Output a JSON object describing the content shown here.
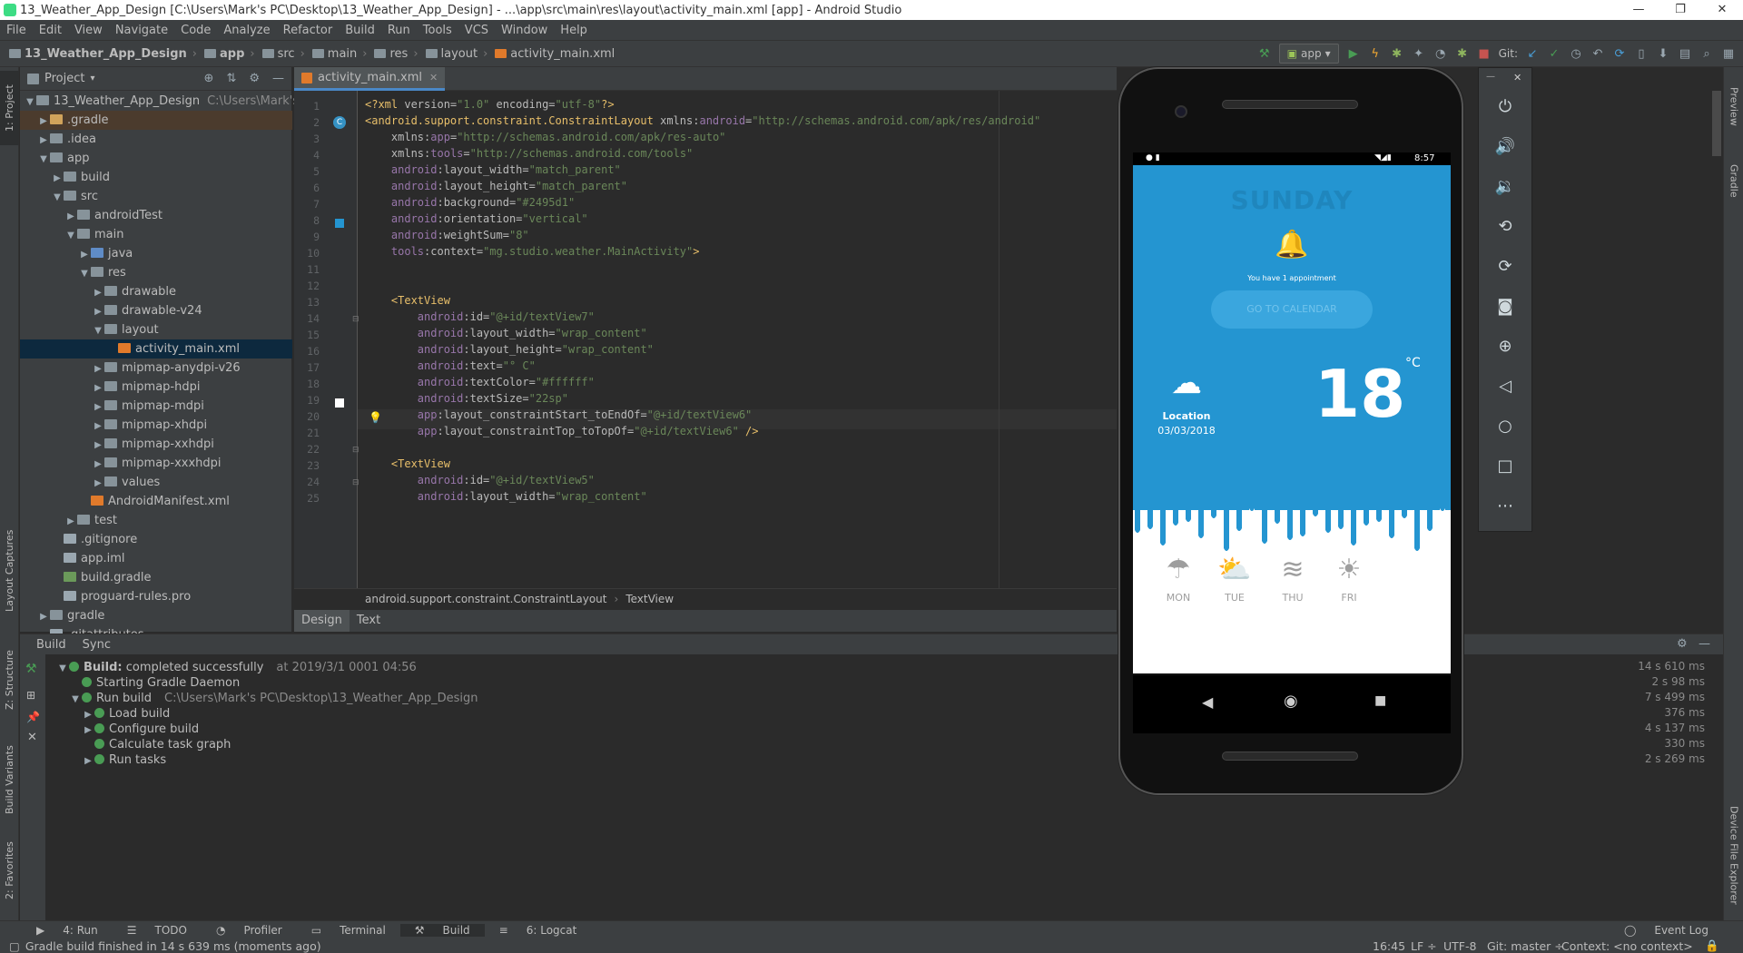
{
  "window": {
    "title": "13_Weather_App_Design [C:\\Users\\Mark's PC\\Desktop\\13_Weather_App_Design] - ...\\app\\src\\main\\res\\layout\\activity_main.xml [app] - Android Studio",
    "controls": [
      "—",
      "❐",
      "✕"
    ]
  },
  "menu": [
    "File",
    "Edit",
    "View",
    "Navigate",
    "Code",
    "Analyze",
    "Refactor",
    "Build",
    "Run",
    "Tools",
    "VCS",
    "Window",
    "Help"
  ],
  "breadcrumb": [
    "13_Weather_App_Design",
    "app",
    "src",
    "main",
    "res",
    "layout",
    "activity_main.xml"
  ],
  "toolbar": {
    "config": "app",
    "git_label": "Git:"
  },
  "project": {
    "header": "Project",
    "items": [
      {
        "label": "13_Weather_App_Design",
        "hint": "C:\\Users\\Mark's PC",
        "depth": 0,
        "arrow": "▼",
        "icon": "fold",
        "bold": false
      },
      {
        "label": ".gradle",
        "depth": 1,
        "arrow": "▶",
        "icon": "fold-o",
        "hl": true
      },
      {
        "label": ".idea",
        "depth": 1,
        "arrow": "▶",
        "icon": "fold"
      },
      {
        "label": "app",
        "depth": 1,
        "arrow": "▼",
        "icon": "fold"
      },
      {
        "label": "build",
        "depth": 2,
        "arrow": "▶",
        "icon": "fold"
      },
      {
        "label": "src",
        "depth": 2,
        "arrow": "▼",
        "icon": "fold"
      },
      {
        "label": "androidTest",
        "depth": 3,
        "arrow": "▶",
        "icon": "fold"
      },
      {
        "label": "main",
        "depth": 3,
        "arrow": "▼",
        "icon": "fold"
      },
      {
        "label": "java",
        "depth": 4,
        "arrow": "▶",
        "icon": "fold-b"
      },
      {
        "label": "res",
        "depth": 4,
        "arrow": "▼",
        "icon": "fold"
      },
      {
        "label": "drawable",
        "depth": 5,
        "arrow": "▶",
        "icon": "fold"
      },
      {
        "label": "drawable-v24",
        "depth": 5,
        "arrow": "▶",
        "icon": "fold"
      },
      {
        "label": "layout",
        "depth": 5,
        "arrow": "▼",
        "icon": "fold"
      },
      {
        "label": "activity_main.xml",
        "depth": 6,
        "arrow": "",
        "icon": "file-x",
        "sel": true
      },
      {
        "label": "mipmap-anydpi-v26",
        "depth": 5,
        "arrow": "▶",
        "icon": "fold"
      },
      {
        "label": "mipmap-hdpi",
        "depth": 5,
        "arrow": "▶",
        "icon": "fold"
      },
      {
        "label": "mipmap-mdpi",
        "depth": 5,
        "arrow": "▶",
        "icon": "fold"
      },
      {
        "label": "mipmap-xhdpi",
        "depth": 5,
        "arrow": "▶",
        "icon": "fold"
      },
      {
        "label": "mipmap-xxhdpi",
        "depth": 5,
        "arrow": "▶",
        "icon": "fold"
      },
      {
        "label": "mipmap-xxxhdpi",
        "depth": 5,
        "arrow": "▶",
        "icon": "fold"
      },
      {
        "label": "values",
        "depth": 5,
        "arrow": "▶",
        "icon": "fold"
      },
      {
        "label": "AndroidManifest.xml",
        "depth": 4,
        "arrow": "",
        "icon": "file-x"
      },
      {
        "label": "test",
        "depth": 3,
        "arrow": "▶",
        "icon": "fold"
      },
      {
        "label": ".gitignore",
        "depth": 2,
        "arrow": "",
        "icon": "file-i"
      },
      {
        "label": "app.iml",
        "depth": 2,
        "arrow": "",
        "icon": "file-i"
      },
      {
        "label": "build.gradle",
        "depth": 2,
        "arrow": "",
        "icon": "file-g"
      },
      {
        "label": "proguard-rules.pro",
        "depth": 2,
        "arrow": "",
        "icon": "file-i"
      },
      {
        "label": "gradle",
        "depth": 1,
        "arrow": "▶",
        "icon": "fold"
      },
      {
        "label": ".gitattributes",
        "depth": 1,
        "arrow": "",
        "icon": "file-i"
      }
    ]
  },
  "editor": {
    "tab": "activity_main.xml",
    "lines": [
      {
        "n": "1",
        "html": "<span class='tag'>&lt;?xml </span><span class='attr'>version=</span><span class='val'>\"1.0\"</span><span class='attr'> encoding=</span><span class='val'>\"utf-8\"</span><span class='tag'>?&gt;</span>"
      },
      {
        "n": "2",
        "html": "<span class='tag'>&lt;android.support.constraint.ConstraintLayout </span><span class='attr'>xmlns:</span><span class='ns'>android</span><span class='attr'>=</span><span class='val'>\"http://schemas.android.com/apk/res/android\"</span>"
      },
      {
        "n": "3",
        "html": "    <span class='attr'>xmlns:</span><span class='ns'>app</span><span class='attr'>=</span><span class='val'>\"http://schemas.android.com/apk/res-auto\"</span>"
      },
      {
        "n": "4",
        "html": "    <span class='attr'>xmlns:</span><span class='ns'>tools</span><span class='attr'>=</span><span class='val'>\"http://schemas.android.com/tools\"</span>"
      },
      {
        "n": "5",
        "html": "    <span class='ns'>android</span><span class='attr'>:layout_width=</span><span class='val'>\"match_parent\"</span>"
      },
      {
        "n": "6",
        "html": "    <span class='ns'>android</span><span class='attr'>:layout_height=</span><span class='val'>\"match_parent\"</span>"
      },
      {
        "n": "7",
        "html": "    <span class='ns'>android</span><span class='attr'>:background=</span><span class='val'>\"#2495d1\"</span>"
      },
      {
        "n": "8",
        "html": "    <span class='ns'>android</span><span class='attr'>:orientation=</span><span class='val'>\"vertical\"</span>"
      },
      {
        "n": "9",
        "html": "    <span class='ns'>android</span><span class='attr'>:weightSum=</span><span class='val'>\"8\"</span>"
      },
      {
        "n": "10",
        "html": "    <span class='ns'>tools</span><span class='attr'>:context=</span><span class='val'>\"mg.studio.weather.MainActivity\"</span><span class='tag'>&gt;</span>"
      },
      {
        "n": "11",
        "html": ""
      },
      {
        "n": "12",
        "html": ""
      },
      {
        "n": "13",
        "html": "    <span class='tag'>&lt;TextView</span>"
      },
      {
        "n": "14",
        "html": "        <span class='ns'>android</span><span class='attr'>:id=</span><span class='val'>\"@+id/textView7\"</span>"
      },
      {
        "n": "15",
        "html": "        <span class='ns'>android</span><span class='attr'>:layout_width=</span><span class='val'>\"wrap_content\"</span>"
      },
      {
        "n": "16",
        "html": "        <span class='ns'>android</span><span class='attr'>:layout_height=</span><span class='val'>\"wrap_content\"</span>"
      },
      {
        "n": "17",
        "html": "        <span class='ns'>android</span><span class='attr'>:text=</span><span class='val'>\"° C\"</span>"
      },
      {
        "n": "18",
        "html": "        <span class='ns'>android</span><span class='attr'>:textColor=</span><span class='val'>\"#ffffff\"</span>"
      },
      {
        "n": "19",
        "html": "        <span class='ns'>android</span><span class='attr'>:textSize=</span><span class='val'>\"22sp\"</span>"
      },
      {
        "n": "20",
        "html": "        <span class='ns'>app</span><span class='attr'>:layout_constraintStart_toEndOf=</span><span class='val'>\"@+id/textView6\"</span>"
      },
      {
        "n": "21",
        "html": "        <span class='ns'>app</span><span class='attr'>:layout_constraintTop_toTopOf=</span><span class='val'>\"@+id/textView6\"</span><span class='tag'> /&gt;</span>"
      },
      {
        "n": "22",
        "html": ""
      },
      {
        "n": "23",
        "html": "    <span class='tag'>&lt;TextView</span>"
      },
      {
        "n": "24",
        "html": "        <span class='ns'>android</span><span class='attr'>:id=</span><span class='val'>\"@+id/textView5\"</span>"
      },
      {
        "n": "25",
        "html": "        <span class='ns'>android</span><span class='attr'>:layout_width=</span><span class='val'>\"wrap_content\"</span>"
      }
    ],
    "crumbs": [
      "android.support.constraint.ConstraintLayout",
      "TextView"
    ],
    "design_tabs": [
      "Design",
      "Text"
    ]
  },
  "build": {
    "tabs": [
      "Build",
      "Sync"
    ],
    "rows": [
      {
        "label": "Build:",
        "rest": " completed successfully",
        "extra": "at 2019/3/1 0001 04:56",
        "time": "14 s 610 ms",
        "depth": 0,
        "arrow": "▼"
      },
      {
        "label": "Starting Gradle Daemon",
        "time": "2 s 98 ms",
        "depth": 1,
        "arrow": ""
      },
      {
        "label": "Run build",
        "extra": "C:\\Users\\Mark's PC\\Desktop\\13_Weather_App_Design",
        "time": "7 s 499 ms",
        "depth": 1,
        "arrow": "▼"
      },
      {
        "label": "Load build",
        "time": "376 ms",
        "depth": 2,
        "arrow": "▶"
      },
      {
        "label": "Configure build",
        "time": "4 s 137 ms",
        "depth": 2,
        "arrow": "▶"
      },
      {
        "label": "Calculate task graph",
        "time": "330 ms",
        "depth": 2,
        "arrow": ""
      },
      {
        "label": "Run tasks",
        "time": "2 s 269 ms",
        "depth": 2,
        "arrow": "▶"
      }
    ]
  },
  "bottom_tabs": [
    {
      "label": "4: Run",
      "icon": "run-icon"
    },
    {
      "label": "TODO",
      "icon": "todo-icon"
    },
    {
      "label": "Profiler",
      "icon": "profiler-icon"
    },
    {
      "label": "Terminal",
      "icon": "terminal-icon"
    },
    {
      "label": "Build",
      "icon": "build-icon"
    },
    {
      "label": "6: Logcat",
      "icon": "logcat-icon"
    }
  ],
  "event_log": "Event Log",
  "status": {
    "message": "Gradle build finished in 14 s 639 ms (moments ago)",
    "position": "16:45",
    "line_sep": "LF ÷",
    "encoding": "UTF-8",
    "git": "Git: master ÷",
    "context": "Context: <no context>"
  },
  "left_vtabs": [
    "1: Project",
    "Layout Captures",
    "Z: Structure",
    "Build Variants",
    "2: Favorites"
  ],
  "right_vtabs": [
    "Preview",
    "Gradle",
    "Device File Explorer"
  ],
  "phone": {
    "time": "8:57",
    "day": "SUNDAY",
    "appointment": "You have 1 appointment",
    "calendar_button": "GO TO CALENDAR",
    "location": "Location",
    "date": "03/03/2018",
    "temperature": "18",
    "unit": "°C",
    "forecast": [
      "MON",
      "TUE",
      "THU",
      "FRI"
    ],
    "colors": {
      "sky": "#2495d1",
      "wave": "#2495d1"
    }
  }
}
